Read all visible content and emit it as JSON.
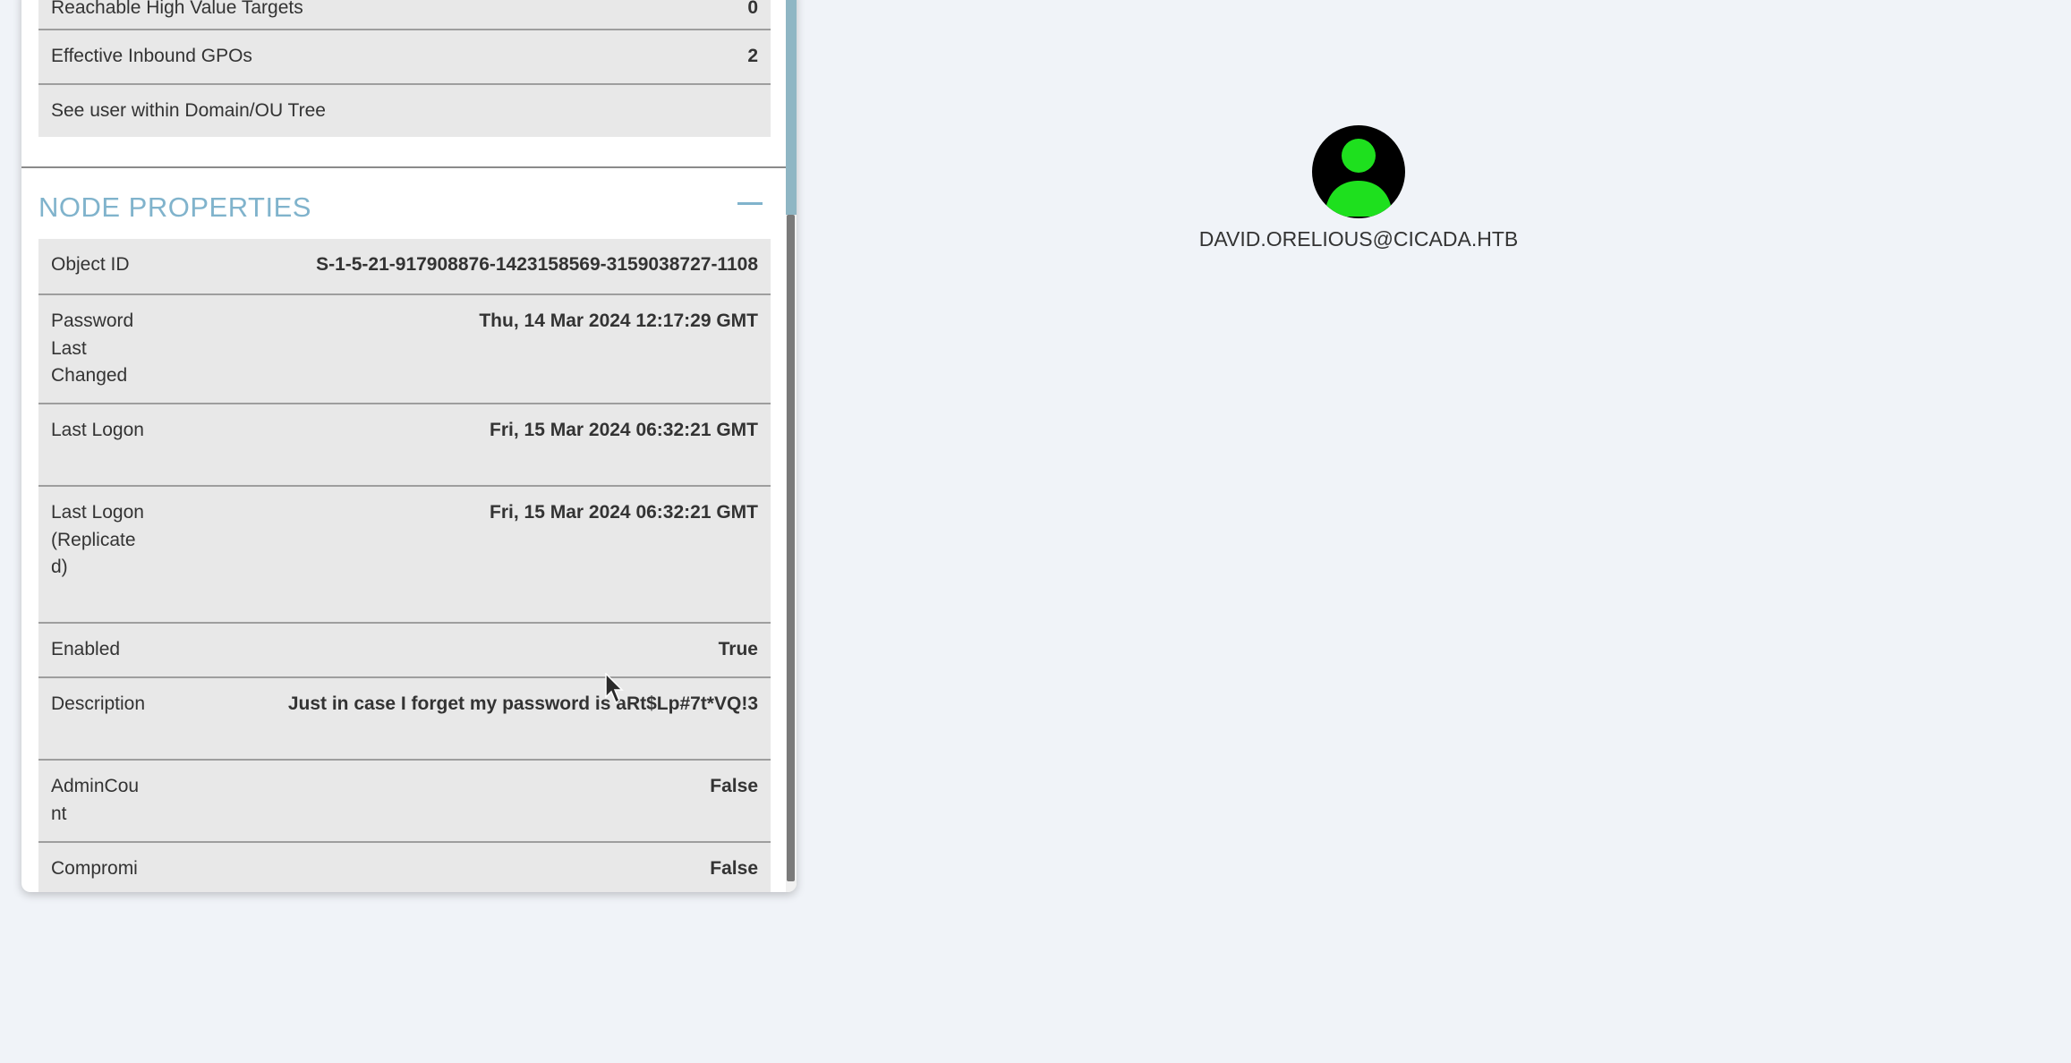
{
  "panel": {
    "top_rows": [
      {
        "label": "Reachable High Value Targets",
        "value": "0"
      },
      {
        "label": "Effective Inbound GPOs",
        "value": "2"
      },
      {
        "label": "See user within Domain/OU Tree",
        "value": ""
      }
    ],
    "section": {
      "title": "NODE PROPERTIES",
      "collapse_icon": "minus-icon",
      "rows": [
        {
          "label": "Object ID",
          "value": "S-1-5-21-917908876-1423158569-3159038727-1108"
        },
        {
          "label": "Password Last Changed",
          "value": "Thu, 14 Mar 2024 12:17:29 GMT"
        },
        {
          "label": "Last Logon",
          "value": "Fri, 15 Mar 2024 06:32:21 GMT"
        },
        {
          "label": "Last Logon (Replicated)",
          "value": "Fri, 15 Mar 2024 06:32:21 GMT"
        },
        {
          "label": "Enabled",
          "value": "True"
        },
        {
          "label": "Description",
          "value": "Just in case I forget my password is aRt$Lp#7t*VQ!3"
        },
        {
          "label": "AdminCount",
          "value": "False"
        },
        {
          "label": "Compromi",
          "value": "False"
        }
      ]
    }
  },
  "graph": {
    "node_label": "DAVID.ORELIOUS@CICADA.HTB",
    "node_icon": "user-icon",
    "node_fill": "#000000",
    "icon_color": "#1ee01e"
  },
  "colors": {
    "background": "#f0f3f8",
    "accent": "#80b3cc",
    "row_background": "#e8e8e8"
  }
}
